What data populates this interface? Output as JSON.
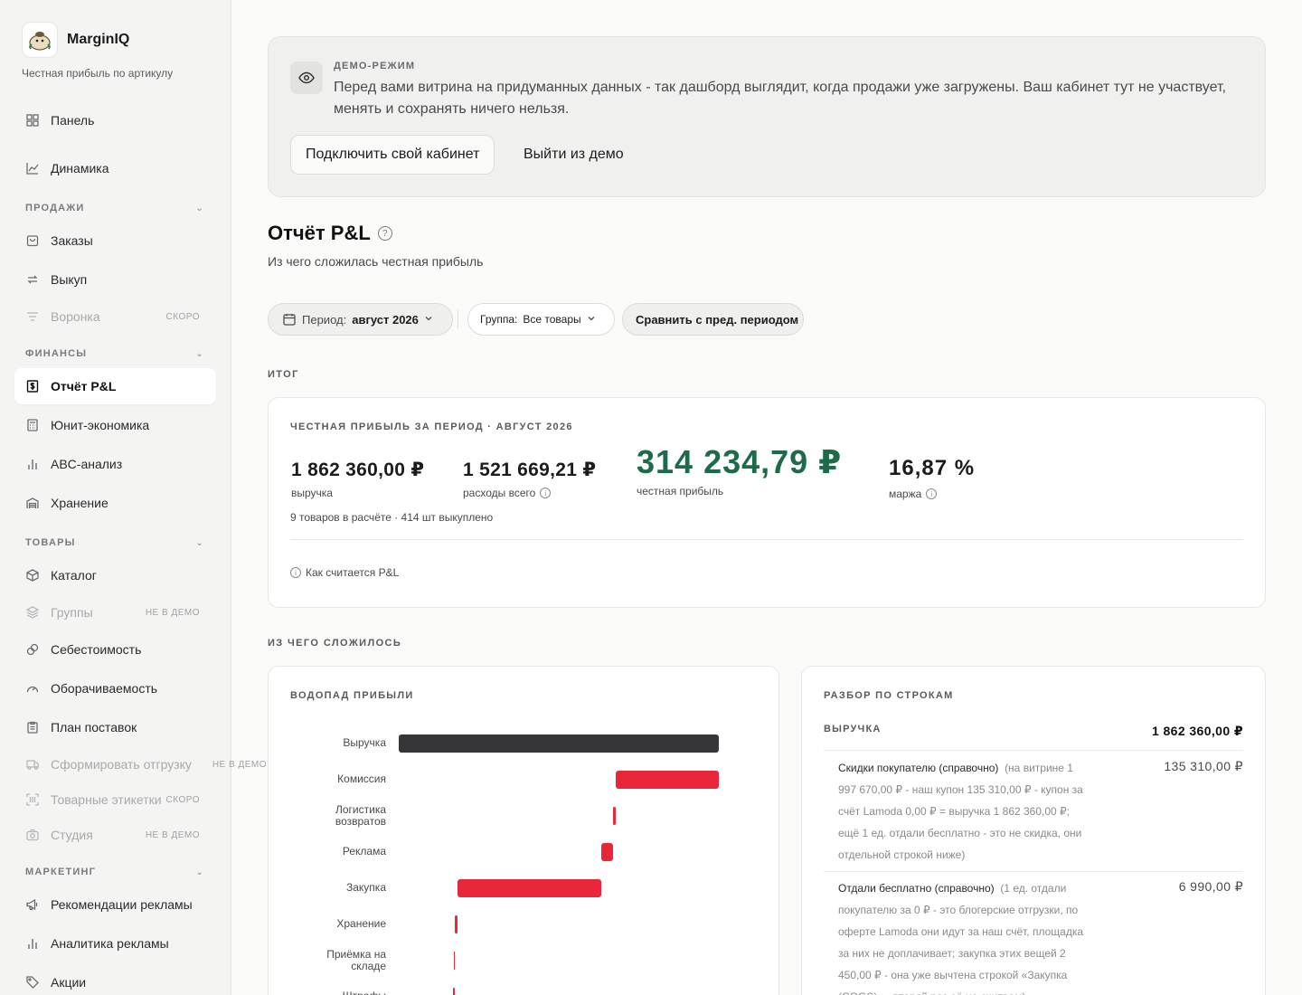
{
  "brand": {
    "name": "MarginIQ",
    "tagline": "Честная прибыль по артикулу"
  },
  "sidebar": {
    "top_items": [
      {
        "label": "Панель",
        "icon": "grid-icon"
      },
      {
        "label": "Динамика",
        "icon": "line-chart-icon"
      }
    ],
    "sections": [
      {
        "label": "ПРОДАЖИ",
        "items": [
          {
            "label": "Заказы",
            "icon": "bag-icon"
          },
          {
            "label": "Выкуп",
            "icon": "refresh-icon"
          },
          {
            "label": "Воронка",
            "icon": "funnel-icon",
            "badge": "СКОРО"
          }
        ]
      },
      {
        "label": "ФИНАНСЫ",
        "items": [
          {
            "label": "Отчёт P&L",
            "icon": "dollar-doc-icon",
            "active": true
          },
          {
            "label": "Юнит-экономика",
            "icon": "calculator-icon"
          },
          {
            "label": "ABC-анализ",
            "icon": "bar-chart-icon"
          },
          {
            "label": "Хранение",
            "icon": "warehouse-icon"
          }
        ]
      },
      {
        "label": "ТОВАРЫ",
        "items": [
          {
            "label": "Каталог",
            "icon": "box-icon"
          },
          {
            "label": "Группы",
            "icon": "layers-icon",
            "badge": "НЕ В ДЕМО"
          },
          {
            "label": "Себестоимость",
            "icon": "coins-icon"
          },
          {
            "label": "Оборачиваемость",
            "icon": "gauge-icon"
          },
          {
            "label": "План поставок",
            "icon": "clipboard-icon"
          },
          {
            "label": "Сформировать отгрузку",
            "icon": "truck-icon",
            "badge": "НЕ В ДЕМО"
          },
          {
            "label": "Товарные этикетки",
            "icon": "barcode-icon",
            "badge": "СКОРО"
          },
          {
            "label": "Студия",
            "icon": "camera-icon",
            "badge": "НЕ В ДЕМО"
          }
        ]
      },
      {
        "label": "МАРКЕТИНГ",
        "items": [
          {
            "label": "Рекомендации рекламы",
            "icon": "megaphone-icon"
          },
          {
            "label": "Аналитика рекламы",
            "icon": "bar-chart-icon"
          },
          {
            "label": "Акции",
            "icon": "tag-icon"
          }
        ]
      }
    ]
  },
  "demo": {
    "tag": "ДЕМО-РЕЖИМ",
    "text": "Перед вами витрина на придуманных данных - так дашборд выглядит, когда продажи уже загружены. Ваш кабинет тут не участвует, менять и сохранять ничего нельзя.",
    "connect_label": "Подключить свой кабинет",
    "exit_label": "Выйти из демо"
  },
  "page": {
    "title": "Отчёт P&L",
    "subtitle": "Из чего сложилась честная прибыль"
  },
  "filters": {
    "period_label": "Период:",
    "period_value": "август 2026",
    "group_label": "Группа:",
    "group_value": "Все товары",
    "compare_label": "Сравнить с пред. периодом"
  },
  "summary": {
    "section_title": "ИТОГ",
    "card_label": "ЧЕСТНАЯ ПРИБЫЛЬ ЗА ПЕРИОД · АВГУСТ 2026",
    "revenue": {
      "value": "1 862 360,00 ₽",
      "label": "выручка"
    },
    "expenses": {
      "value": "1 521 669,21 ₽",
      "label": "расходы всего"
    },
    "profit": {
      "value": "314 234,79 ₽",
      "label": "честная прибыль"
    },
    "margin": {
      "value": "16,87 %",
      "label": "маржа"
    },
    "count_line": "9 товаров в расчёте · 414 шт выкуплено",
    "how_link": "Как считается P&L",
    "profit_color": "#1e6b4a"
  },
  "composition": {
    "section_title": "ИЗ ЧЕГО СЛОЖИЛОСЬ"
  },
  "waterfall": {
    "title": "ВОДОПАД ПРИБЫЛИ",
    "colors": {
      "total": "#363638",
      "expense": "#e8283a"
    },
    "rows": [
      {
        "label": "Выручка",
        "start": 0,
        "end": 1862360,
        "kind": "total"
      },
      {
        "label": "Комиссия",
        "start": 1262000,
        "end": 1862360,
        "kind": "expense"
      },
      {
        "label": "Логистика возвратов",
        "start": 1245000,
        "end": 1262000,
        "kind": "expense"
      },
      {
        "label": "Реклама",
        "start": 1178000,
        "end": 1245000,
        "kind": "expense"
      },
      {
        "label": "Закупка",
        "start": 340000,
        "end": 1178000,
        "kind": "expense"
      },
      {
        "label": "Хранение",
        "start": 326000,
        "end": 340000,
        "kind": "expense"
      },
      {
        "label": "Приёмка на складе",
        "start": 320000,
        "end": 326000,
        "kind": "expense"
      },
      {
        "label": "Штрафы",
        "start": 317000,
        "end": 320000,
        "kind": "expense"
      }
    ],
    "max": 1862360
  },
  "breakdown": {
    "title": "РАЗБОР ПО СТРОКАМ",
    "revenue_label": "ВЫРУЧКА",
    "revenue_amount": "1 862 360,00 ₽",
    "items": [
      {
        "name": "Скидки покупателю (справочно)",
        "note": "(на витрине 1 997 670,00 ₽ - наш купон 135 310,00 ₽ - купон за счёт Lamoda 0,00 ₽ = выручка 1 862 360,00 ₽; ещё 1 ед. отдали бесплатно - это не скидка, они отдельной строкой ниже)",
        "amount": "135 310,00 ₽"
      },
      {
        "name": "Отдали бесплатно (справочно)",
        "note": "(1 ед. отдали покупателю за 0 ₽ - это блогерские отгрузки, по оферте Lamoda они идут за наш счёт, площадка за них не доплачивает; закупка этих вещей 2 450,00 ₽ - она уже вычтена строкой «Закупка (COGS)» - второй раз её не считаем)",
        "amount": "6 990,00 ₽"
      }
    ]
  }
}
